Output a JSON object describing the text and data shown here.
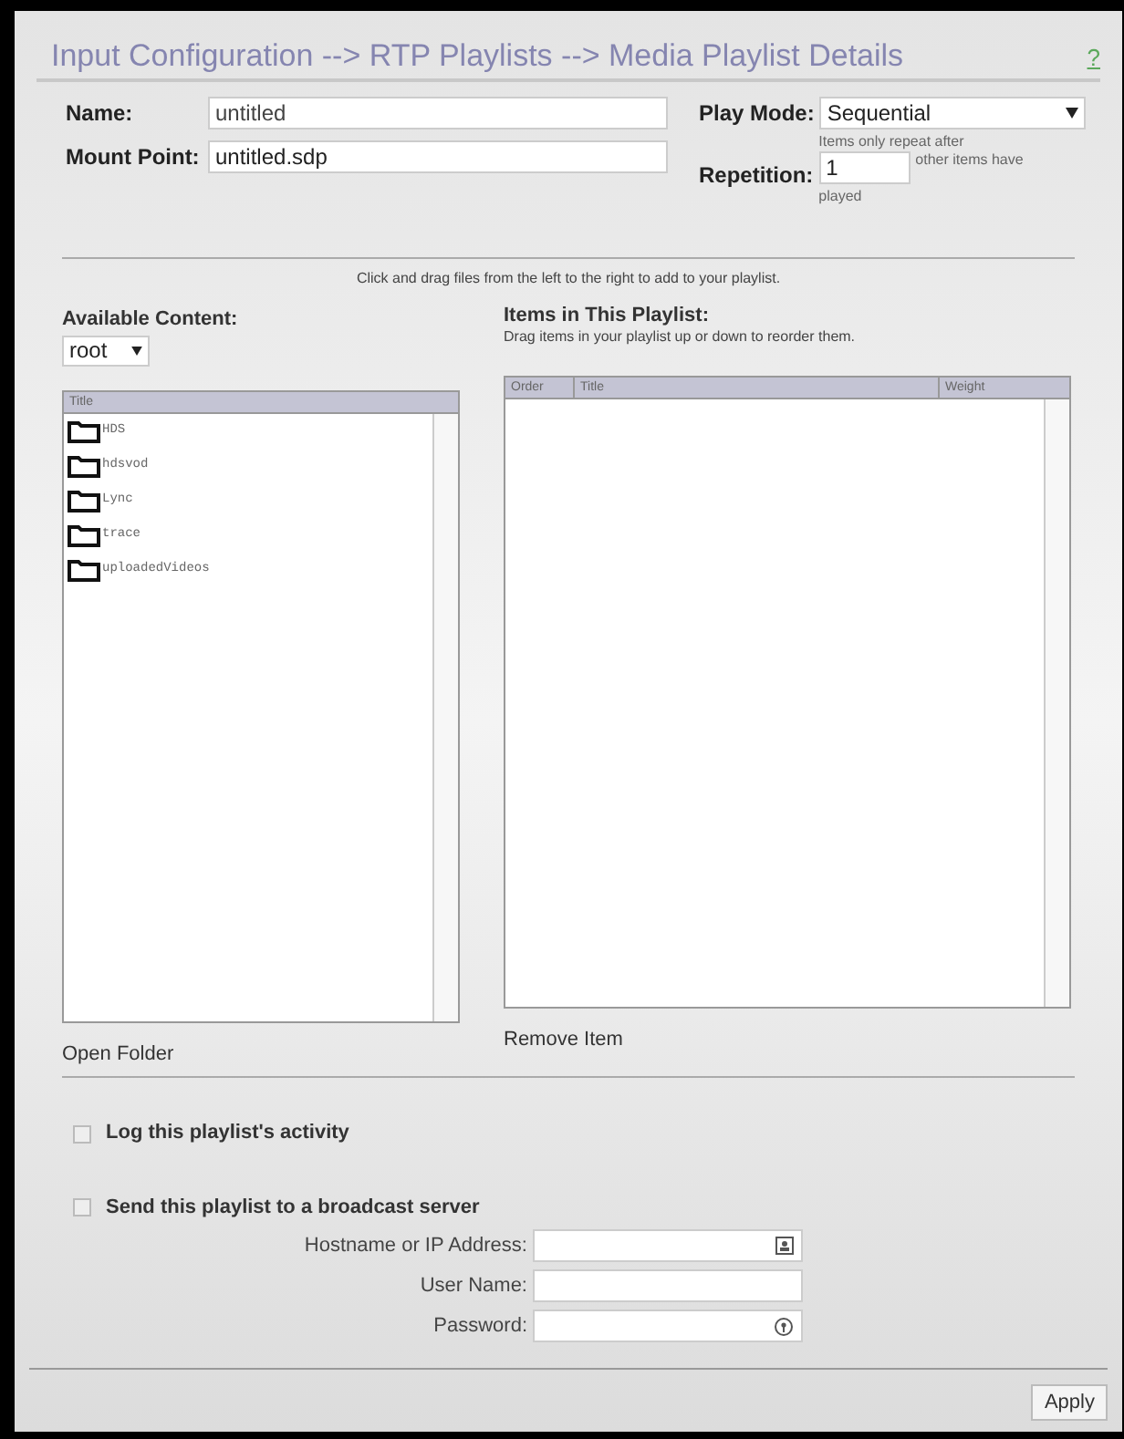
{
  "title": "Input Configuration --> RTP Playlists --> Media Playlist Details",
  "help": "?",
  "name": {
    "label": "Name:",
    "value": "untitled"
  },
  "mount_point": {
    "label": "Mount Point:",
    "value": "untitled.sdp"
  },
  "play_mode": {
    "label": "Play Mode:",
    "value": "Sequential"
  },
  "repetition": {
    "label": "Repetition:",
    "value": "1",
    "hint_before": "Items only repeat after",
    "hint_after": "other items have",
    "hint_end": "played"
  },
  "instructions": "Click and drag files from the left to the right to add to your playlist.",
  "available": {
    "label": "Available Content:",
    "folder": "root",
    "columns": [
      "Title"
    ],
    "items": [
      {
        "name": "HDS"
      },
      {
        "name": "hdsvod"
      },
      {
        "name": "Lync"
      },
      {
        "name": "trace"
      },
      {
        "name": "uploadedVideos"
      }
    ],
    "action": "Open Folder"
  },
  "playlist": {
    "label": "Items in This Playlist:",
    "hint": "Drag items in your playlist up or down to reorder them.",
    "columns": [
      "Order",
      "Title",
      "Weight"
    ],
    "action": "Remove Item"
  },
  "options": [
    {
      "label": "Log this playlist's activity",
      "checked": false
    },
    {
      "label": "Send this playlist to a broadcast server",
      "checked": false
    }
  ],
  "server_fields": [
    {
      "label": "Hostname or IP Address:",
      "kind": "contact"
    },
    {
      "label": "User Name:",
      "kind": "plain"
    },
    {
      "label": "Password:",
      "kind": "key"
    }
  ],
  "apply": "Apply"
}
